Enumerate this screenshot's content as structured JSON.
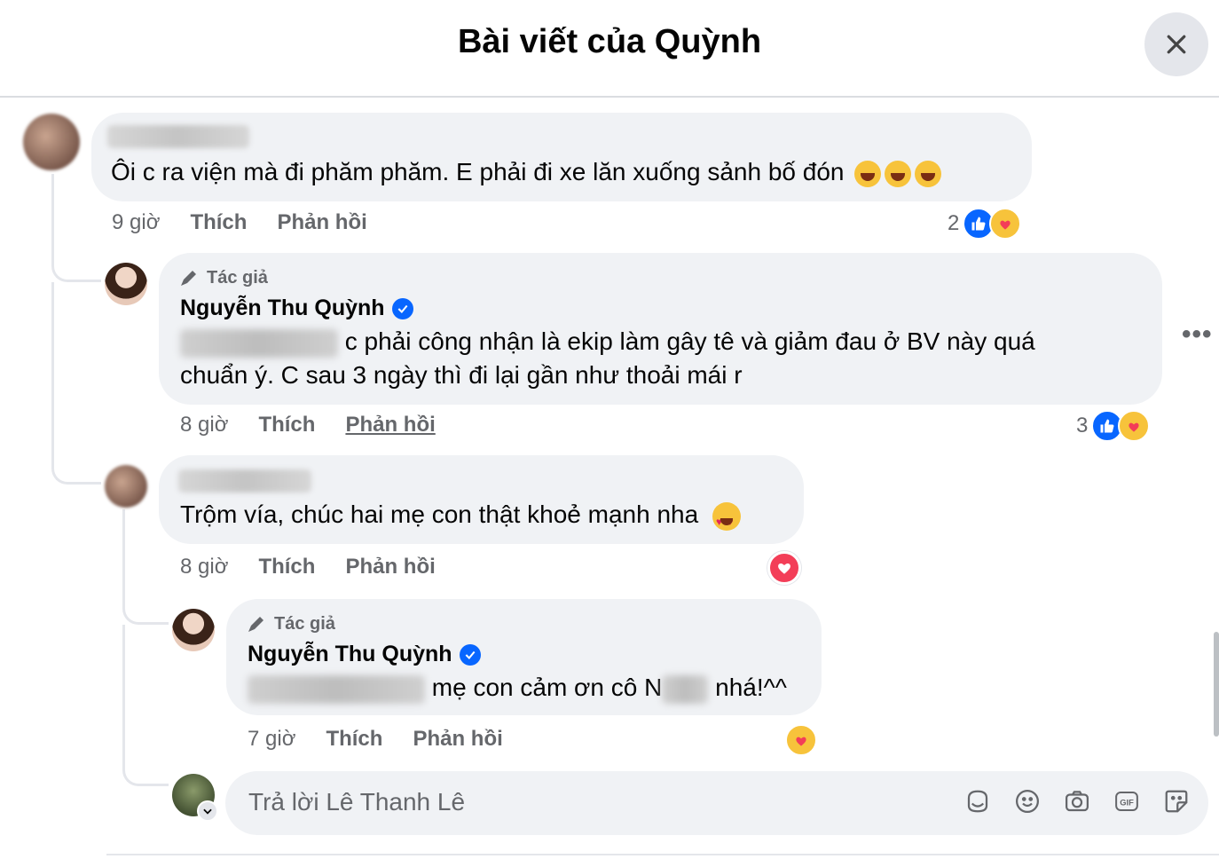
{
  "header": {
    "title": "Bài viết của Quỳnh"
  },
  "comments": [
    {
      "text": "Ôi c ra viện mà đi phăm phăm. E phải đi xe lăn xuống sảnh bố đón",
      "time": "9 giờ",
      "like_label": "Thích",
      "reply_label": "Phản hồi",
      "reaction_count": "2"
    },
    {
      "author_tag": "Tác giả",
      "author": "Nguyễn Thu Quỳnh",
      "text_line1": "c phải công nhận là ekip làm gây tê và giảm đau ở BV này quá",
      "text_line2": "chuẩn ý. C sau 3 ngày thì đi lại gần như thoải mái r",
      "time": "8 giờ",
      "like_label": "Thích",
      "reply_label": "Phản hồi",
      "reaction_count": "3"
    },
    {
      "text": "Trộm vía, chúc hai mẹ con thật khoẻ mạnh nha",
      "time": "8 giờ",
      "like_label": "Thích",
      "reply_label": "Phản hồi"
    },
    {
      "author_tag": "Tác giả",
      "author": "Nguyễn Thu Quỳnh",
      "text_part1": "mẹ con cảm ơn cô N",
      "text_part2": "nhá!^^",
      "time": "7 giờ",
      "like_label": "Thích",
      "reply_label": "Phản hồi"
    }
  ],
  "reply_box": {
    "placeholder": "Trả lời Lê Thanh Lê"
  },
  "icons": [
    "close-icon",
    "pen-icon",
    "verified-icon",
    "like-icon",
    "care-icon",
    "heart-icon",
    "more-icon",
    "avatar-sticker-icon",
    "smile-icon",
    "camera-icon",
    "gif-icon",
    "sticker-icon"
  ],
  "colors": {
    "accent": "#0866ff",
    "bubble": "#f0f2f5",
    "muted": "#65676b",
    "heart": "#f33e58"
  }
}
